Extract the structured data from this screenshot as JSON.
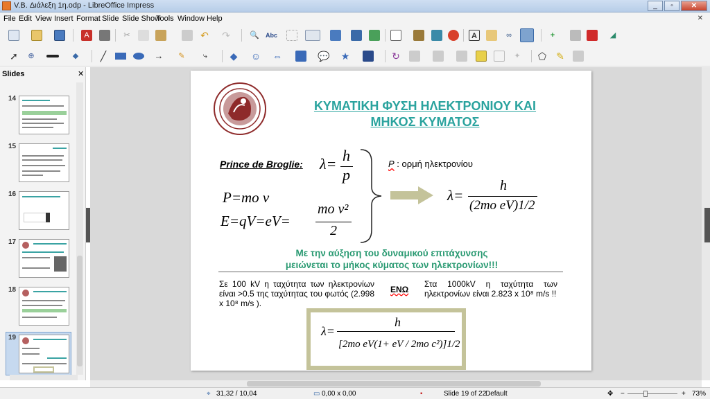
{
  "window": {
    "title": "V.B. Διάλεξη 1η.odp - LibreOffice Impress",
    "minimize": "_",
    "restore": "▫",
    "close": "✕"
  },
  "menu": [
    "File",
    "Edit",
    "View",
    "Insert",
    "Format",
    "Slide",
    "Slide Show",
    "Tools",
    "Window",
    "Help"
  ],
  "menu_close": "✕",
  "sidebar": {
    "title": "Slides",
    "close": "✕",
    "thumbs": [
      "14",
      "15",
      "16",
      "17",
      "18",
      "19"
    ]
  },
  "slide": {
    "title_line1": "ΚΥΜΑΤΙΚΗ ΦΥΣΗ ΗΛΕΚΤΡΟΝΙΟΥ ΚΑΙ",
    "title_line2": "ΜΗΚΟΣ ΚΥΜΑΤΟΣ",
    "prince": "Prince de Broglie:",
    "p_note_symbol": "P",
    "p_note": " : ορμή ηλεκτρονίου",
    "eq1_lhs": "λ=",
    "eq1_num": "h",
    "eq1_den": "p",
    "eq2": "P=mo v",
    "eq3": "E=qV=eV=",
    "eq3_num": "mo v²",
    "eq3_den": "2",
    "eq4_lhs": "λ=",
    "eq4_num": "h",
    "eq4_den": "(2mo eV)1/2",
    "green_line1": "Με την αύξηση του δυναμικού επιτάχυνσης",
    "green_line2": "μειώνεται το μήκος κύματος των ηλεκτρονίων!!!",
    "left_text": "Σε 100 kV η ταχύτητα των ηλεκτρονίων είναι >0.5 της ταχύτητας του φωτός (2.998 x 10⁸ m/s ).",
    "eno": "ΕΝΩ",
    "right_text": "Στα 1000kV η ταχύτητα των ηλεκτρονίων είναι 2.823 x 10⁸ m/s !!",
    "box_lhs": "λ=",
    "box_num": "h",
    "box_den": "[2mo eV(1+ eV / 2mo c²)]1/2"
  },
  "status": {
    "position": "31,32 / 10,04",
    "size": "0,00 x 0,00",
    "slide": "Slide 19 of 22",
    "layout": "Default",
    "zoom": "73%"
  },
  "colors": {
    "teal": "#2aa39e",
    "green": "#2a9a72",
    "arrow": "#c4c39a",
    "seal": "#8e2a2a"
  }
}
